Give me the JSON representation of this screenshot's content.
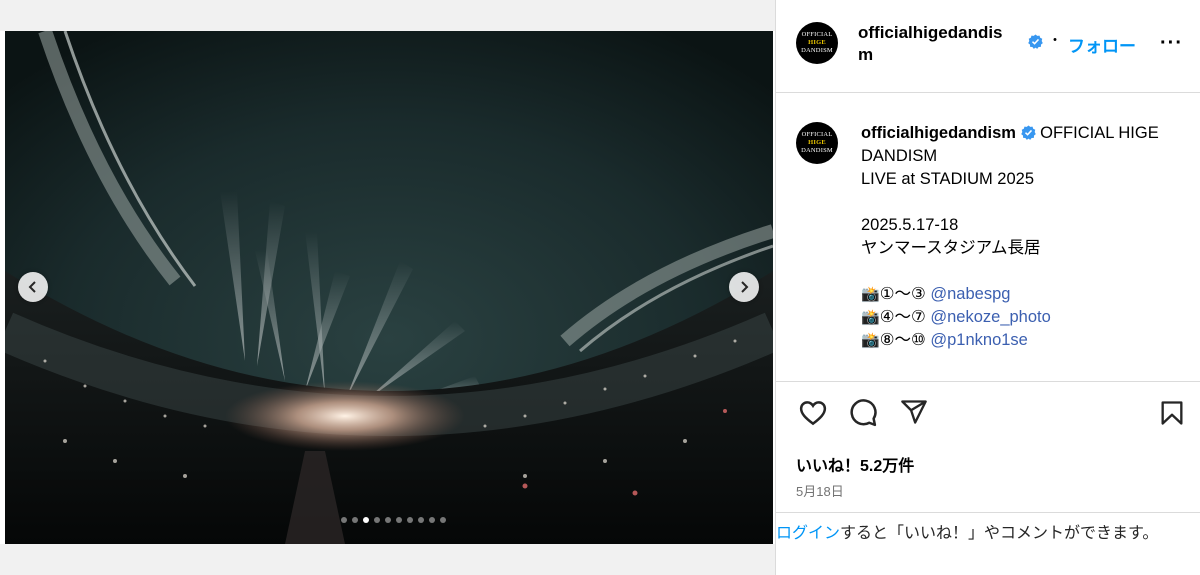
{
  "post": {
    "username": "officialhigedandism",
    "follow_label": "フォロー",
    "separator": "・",
    "more_label": "···",
    "avatar_text": [
      "OFFICIAL",
      "HIGE",
      "DANDISM"
    ]
  },
  "caption": {
    "username": "officialhigedandism",
    "title_inline": "OFFICIAL HIGE",
    "lines": [
      "DANDISM",
      "LIVE at STADIUM 2025",
      "",
      "2025.5.17-18",
      "ヤンマースタジアム長居",
      ""
    ],
    "credits": [
      {
        "icon": "📸",
        "range": "①〜③ ",
        "mention": "@nabespg"
      },
      {
        "icon": "📸",
        "range": "④〜⑦ ",
        "mention": "@nekoze_photo"
      },
      {
        "icon": "📸",
        "range": "⑧〜⑩ ",
        "mention": "@p1nkno1se"
      }
    ]
  },
  "engagement": {
    "likes": "いいね！5.2万件",
    "date": "5月18日"
  },
  "login_prompt": {
    "link": "ログイン",
    "text": "すると「いいね！」やコメントができます。"
  },
  "carousel": {
    "total": 10,
    "active_index": 2
  },
  "colors": {
    "follow": "#0095f6",
    "verified": "#3897f0",
    "mention": "#3b5fb0",
    "secondary_text": "#737373"
  },
  "icons": {
    "prev": "chevron-left-icon",
    "next": "chevron-right-icon",
    "like": "heart-icon",
    "comment": "comment-icon",
    "share": "send-icon",
    "save": "bookmark-icon",
    "verified": "verified-badge-icon"
  }
}
